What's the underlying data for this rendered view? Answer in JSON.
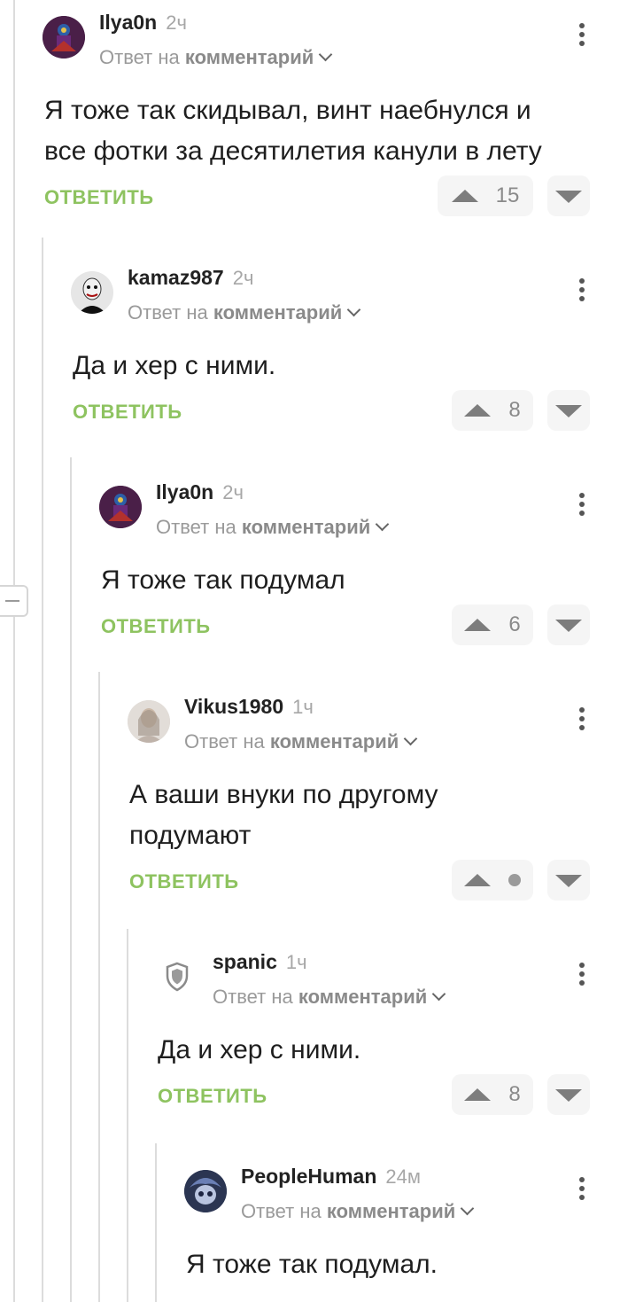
{
  "reply_label": "ОТВЕТИТЬ",
  "reply_to_prefix": "Ответ на",
  "reply_to_target": "комментарий",
  "icons": {
    "upvote": "triangle-up-icon",
    "downvote": "triangle-down-icon",
    "more": "vertical-dots-icon",
    "chevron": "chevron-down-icon",
    "shield": "shield-icon"
  },
  "colors": {
    "reply_green": "#8ec360",
    "muted": "#9a9a9a"
  },
  "comments": [
    {
      "username": "Ilya0n",
      "time": "2ч",
      "text_lines": [
        "Я тоже так скидывал, винт наебнулся и",
        "все фотки за десятилетия канули в лету"
      ],
      "votes": "15"
    },
    {
      "username": "kamaz987",
      "time": "2ч",
      "text_lines": [
        "Да и хер с ними."
      ],
      "votes": "8"
    },
    {
      "username": "Ilya0n",
      "time": "2ч",
      "text_lines": [
        "Я тоже так подумал"
      ],
      "votes": "6"
    },
    {
      "username": "Vikus1980",
      "time": "1ч",
      "text_lines": [
        "А ваши внуки по другому",
        "подумают"
      ],
      "votes": ""
    },
    {
      "username": "spanic",
      "time": "1ч",
      "text_lines": [
        "Да и хер с ними."
      ],
      "votes": "8"
    },
    {
      "username": "PeopleHuman",
      "time": "24м",
      "text_lines": [
        "Я тоже так подумал."
      ],
      "votes": ""
    }
  ]
}
